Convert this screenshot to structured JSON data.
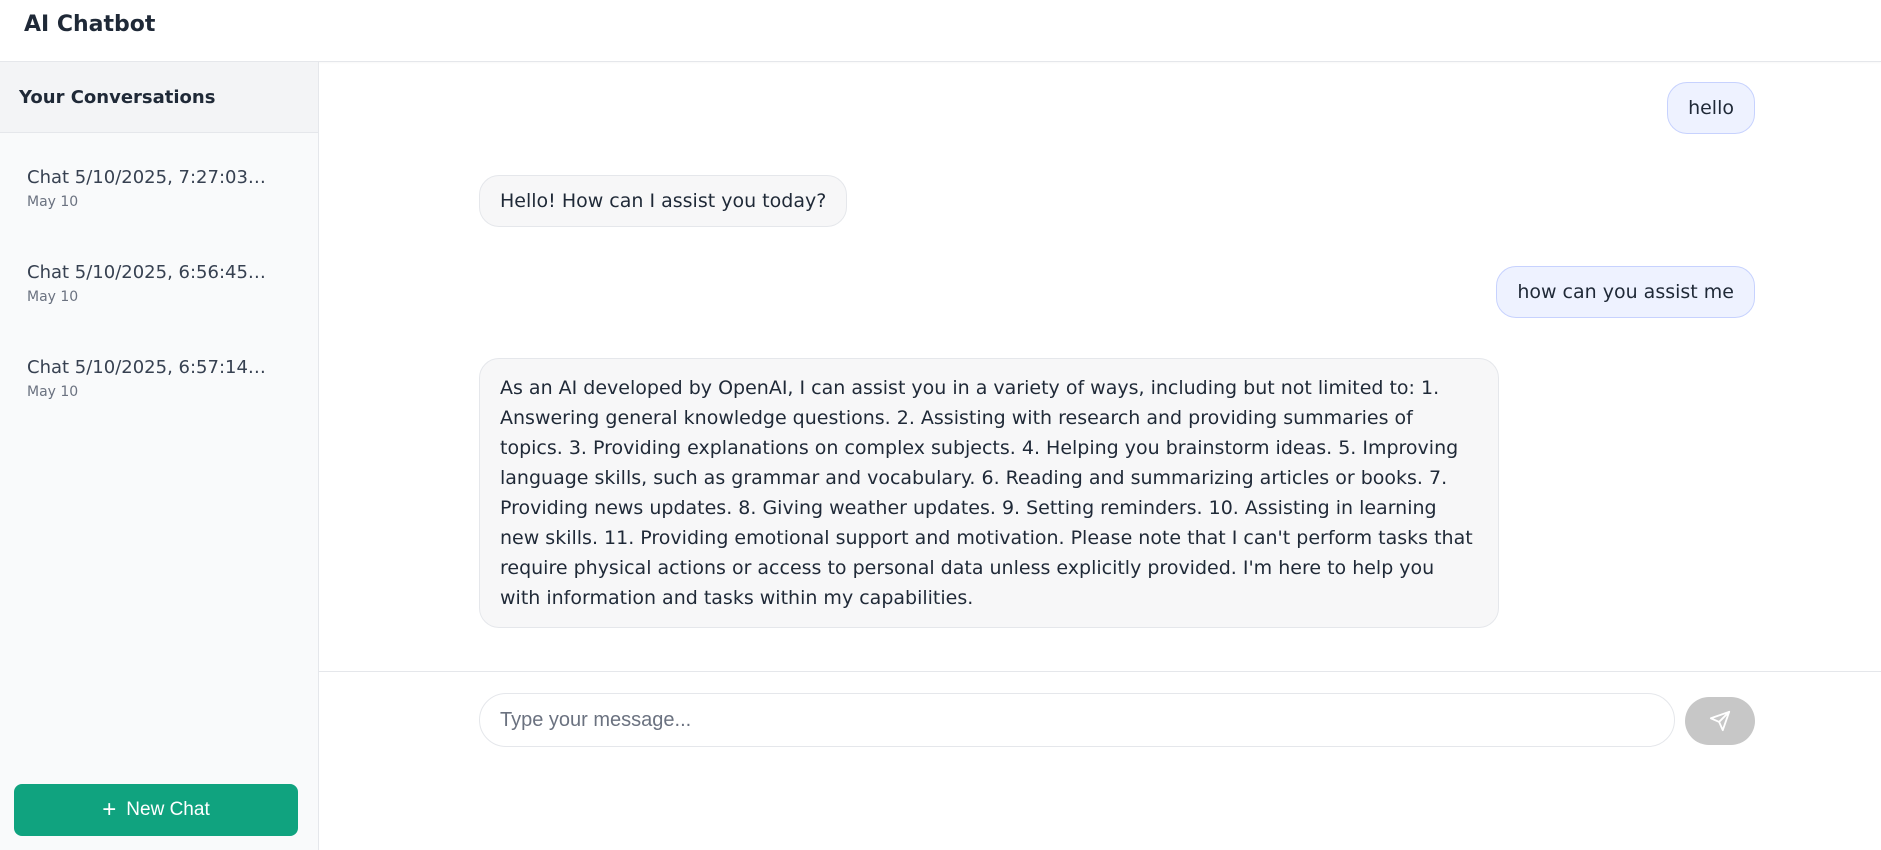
{
  "header": {
    "title": "AI Chatbot"
  },
  "sidebar": {
    "heading": "Your Conversations",
    "conversations": [
      {
        "title": "Chat 5/10/2025, 7:27:03 P...",
        "date": "May 10"
      },
      {
        "title": "Chat 5/10/2025, 6:56:45 P...",
        "date": "May 10"
      },
      {
        "title": "Chat 5/10/2025, 6:57:14 P...",
        "date": "May 10"
      }
    ],
    "new_chat_label": "New Chat",
    "new_chat_icon": "plus-icon"
  },
  "chat": {
    "messages": [
      {
        "role": "user",
        "text": "hello"
      },
      {
        "role": "assistant",
        "text": "Hello! How can I assist you today?"
      },
      {
        "role": "user",
        "text": "how can you assist me"
      },
      {
        "role": "assistant",
        "text": "As an AI developed by OpenAI, I can assist you in a variety of ways, including but not limited to: 1. Answering general knowledge questions. 2. Assisting with research and providing summaries of topics. 3. Providing explanations on complex subjects. 4. Helping you brainstorm ideas. 5. Improving language skills, such as grammar and vocabulary. 6. Reading and summarizing articles or books. 7. Providing news updates. 8. Giving weather updates. 9. Setting reminders. 10. Assisting in learning new skills. 11. Providing emotional support and motivation. Please note that I can't perform tasks that require physical actions or access to personal data unless explicitly provided. I'm here to help you with information and tasks within my capabilities."
      }
    ]
  },
  "composer": {
    "placeholder": "Type your message...",
    "value": "",
    "send_icon": "send-icon"
  },
  "colors": {
    "accent": "#10a37f",
    "user_bubble": "#eef2ff",
    "assistant_bubble": "#f7f7f8",
    "send_disabled": "#c7c7c7"
  }
}
